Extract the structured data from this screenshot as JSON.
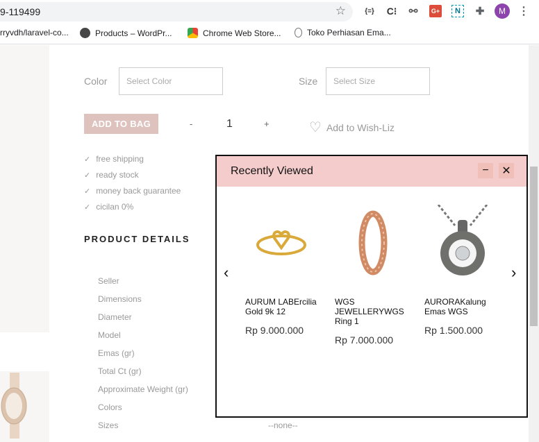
{
  "browser": {
    "url": "9-119499",
    "bookmarks": [
      {
        "label": "rryvdh/laravel-co...",
        "icon": "github-icon"
      },
      {
        "label": "Products – WordPr...",
        "icon": "wordpress-icon"
      },
      {
        "label": "Chrome Web Store...",
        "icon": "chrome-webstore-icon"
      },
      {
        "label": "Toko Perhiasan Ema...",
        "icon": "jewelry-icon"
      }
    ],
    "extensions": [
      "{=}",
      "C⁝",
      "G+",
      "N"
    ],
    "profile_initial": "M"
  },
  "product": {
    "color_label": "Color",
    "color_placeholder": "Select Color",
    "size_label": "Size",
    "size_placeholder": "Select Size",
    "add_to_bag": "ADD TO BAG",
    "qty_minus": "-",
    "qty_value": "1",
    "qty_plus": "+",
    "wishlist": "Add to Wish-Liz",
    "features": [
      "free shipping",
      "ready stock",
      "money back guarantee",
      "cicilan 0%"
    ],
    "details_title": "PRODUCT DETAILS",
    "specs": [
      "Seller",
      "Dimensions",
      "Diameter",
      "Model",
      "Emas (gr)",
      "Total Ct (gr)",
      "Approximate Weight (gr)",
      "Colors",
      "Sizes"
    ],
    "sizes_value": "--none--"
  },
  "recently_viewed": {
    "title": "Recently Viewed",
    "minimize": "−",
    "close": "✕",
    "prev": "‹",
    "next": "›",
    "items": [
      {
        "name": "AURUM LABErcilia Gold 9k 12",
        "price": "Rp 9.000.000"
      },
      {
        "name": "WGS JEWELLERYWGS Ring 1",
        "price": "Rp 7.000.000"
      },
      {
        "name": "AURORAKalung Emas WGS",
        "price": "Rp 1.500.000"
      }
    ]
  }
}
